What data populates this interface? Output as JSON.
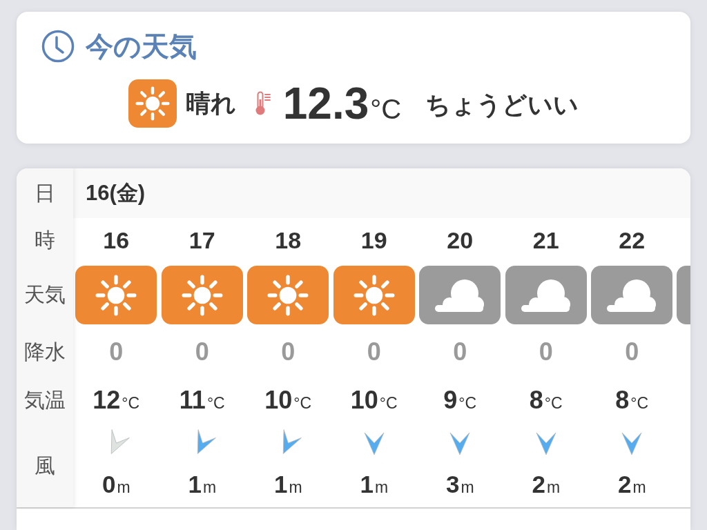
{
  "current": {
    "title": "今の天気",
    "kind": "sunny",
    "condition": "晴れ",
    "temperature": "12.3",
    "temperature_unit": "°C",
    "comment": "ちょうどいい"
  },
  "forecast": {
    "row_labels": [
      "日",
      "時",
      "天気",
      "降水",
      "気温",
      "風"
    ],
    "date": "16(金)",
    "hours": [
      {
        "hour": "16",
        "kind": "sunny",
        "rain": "0",
        "temperature": "12",
        "temperature_unit": "°C",
        "wind": {
          "kind": "nne",
          "color": "#dfe3df",
          "speed": "0",
          "unit": "m"
        }
      },
      {
        "hour": "17",
        "kind": "sunny",
        "rain": "0",
        "temperature": "11",
        "temperature_unit": "°C",
        "wind": {
          "kind": "nne",
          "color": "#55adf0",
          "speed": "1",
          "unit": "m"
        }
      },
      {
        "hour": "18",
        "kind": "sunny",
        "rain": "0",
        "temperature": "10",
        "temperature_unit": "°C",
        "wind": {
          "kind": "nne",
          "color": "#55adf0",
          "speed": "1",
          "unit": "m"
        }
      },
      {
        "hour": "19",
        "kind": "sunny",
        "rain": "0",
        "temperature": "10",
        "temperature_unit": "°C",
        "wind": {
          "kind": "n",
          "color": "#55adf0",
          "speed": "1",
          "unit": "m"
        }
      },
      {
        "hour": "20",
        "kind": "cloudy",
        "rain": "0",
        "temperature": "9",
        "temperature_unit": "°C",
        "wind": {
          "kind": "n",
          "color": "#55adf0",
          "speed": "3",
          "unit": "m"
        }
      },
      {
        "hour": "21",
        "kind": "cloudy",
        "rain": "0",
        "temperature": "8",
        "temperature_unit": "°C",
        "wind": {
          "kind": "n",
          "color": "#55adf0",
          "speed": "2",
          "unit": "m"
        }
      },
      {
        "hour": "22",
        "kind": "cloudy",
        "rain": "0",
        "temperature": "8",
        "temperature_unit": "°C",
        "wind": {
          "kind": "n",
          "color": "#55adf0",
          "speed": "2",
          "unit": "m"
        }
      }
    ],
    "clipped_column": {
      "kind": "cloudy"
    }
  }
}
